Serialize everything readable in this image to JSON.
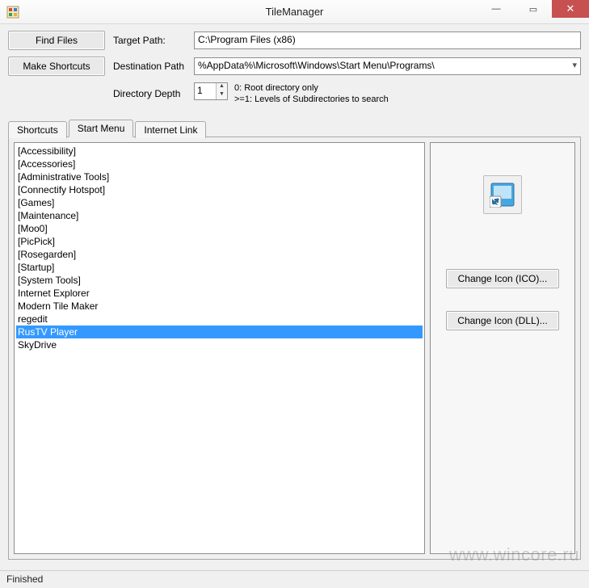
{
  "window": {
    "title": "TileManager"
  },
  "buttons": {
    "find_files": "Find Files",
    "make_shortcuts": "Make Shortcuts",
    "change_icon_ico": "Change Icon (ICO)...",
    "change_icon_dll": "Change Icon (DLL)..."
  },
  "labels": {
    "target_path": "Target Path:",
    "destination_path": "Destination Path",
    "directory_depth": "Directory Depth"
  },
  "fields": {
    "target_path_value": "C:\\Program Files (x86)",
    "destination_path_value": "%AppData%\\Microsoft\\Windows\\Start Menu\\Programs\\",
    "directory_depth_value": "1"
  },
  "hints": {
    "depth_line1": "0: Root directory only",
    "depth_line2": ">=1: Levels of Subdirectories to search"
  },
  "tabs": [
    {
      "label": "Shortcuts",
      "active": false
    },
    {
      "label": "Start Menu",
      "active": true
    },
    {
      "label": "Internet Link",
      "active": false
    }
  ],
  "list": {
    "items": [
      "[Accessibility]",
      "[Accessories]",
      "[Administrative Tools]",
      "[Connectify Hotspot]",
      "[Games]",
      "[Maintenance]",
      "[Moo0]",
      "[PicPick]",
      "[Rosegarden]",
      "[Startup]",
      "[System Tools]",
      "Internet Explorer",
      "Modern Tile Maker",
      "regedit",
      "RusTV Player",
      "SkyDrive"
    ],
    "selected_index": 14
  },
  "status": "Finished",
  "watermark": "www.wincore.ru",
  "win_controls": {
    "minimize": "—",
    "maximize": "▭",
    "close": "✕"
  }
}
